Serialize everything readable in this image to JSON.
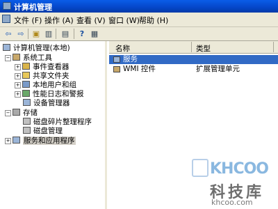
{
  "window": {
    "title": "计算机管理",
    "app_icon": "computer-management-icon"
  },
  "menubar": {
    "items": [
      {
        "label": "文件 (F)"
      },
      {
        "label": "操作 (A)"
      },
      {
        "label": "查看 (V)"
      },
      {
        "label": "窗口 (W)"
      },
      {
        "label": "帮助 (H)"
      }
    ]
  },
  "toolbar": {
    "buttons": [
      {
        "icon": "back-arrow-icon",
        "glyph": "⇦"
      },
      {
        "icon": "forward-arrow-icon",
        "glyph": "⇨"
      },
      {
        "icon": "up-folder-icon",
        "glyph": "▣"
      },
      {
        "icon": "show-hide-tree-icon",
        "glyph": "▥"
      },
      {
        "icon": "export-list-icon",
        "glyph": "▤"
      },
      {
        "icon": "help-icon",
        "glyph": "?"
      },
      {
        "icon": "properties-icon",
        "glyph": "▦"
      }
    ]
  },
  "tree": {
    "items": [
      {
        "label": "计算机管理(本地)",
        "icon": "computer-icon"
      },
      {
        "label": "系统工具",
        "icon": "tools-icon",
        "expander": "−"
      },
      {
        "label": "事件查看器",
        "icon": "event-viewer-icon",
        "expander": "+"
      },
      {
        "label": "共享文件夹",
        "icon": "shared-folder-icon",
        "expander": "+"
      },
      {
        "label": "本地用户和组",
        "icon": "users-icon",
        "expander": "+"
      },
      {
        "label": "性能日志和警报",
        "icon": "performance-icon",
        "expander": "+"
      },
      {
        "label": "设备管理器",
        "icon": "device-manager-icon"
      },
      {
        "label": "存储",
        "icon": "storage-icon",
        "expander": "−"
      },
      {
        "label": "磁盘碎片整理程序",
        "icon": "defrag-icon"
      },
      {
        "label": "磁盘管理",
        "icon": "disk-management-icon"
      },
      {
        "label": "服务和应用程序",
        "icon": "services-apps-icon",
        "expander": "+"
      }
    ]
  },
  "list": {
    "columns": [
      "名称",
      "类型"
    ],
    "rows": [
      {
        "name": "服务",
        "type": "",
        "icon": "services-icon",
        "selected": true
      },
      {
        "name": "WMI 控件",
        "type": "扩展管理单元",
        "icon": "wmi-icon",
        "selected": false
      }
    ]
  },
  "watermark": {
    "brand": "KHCOO",
    "cn": "科技库",
    "url": "khcoo.com"
  }
}
